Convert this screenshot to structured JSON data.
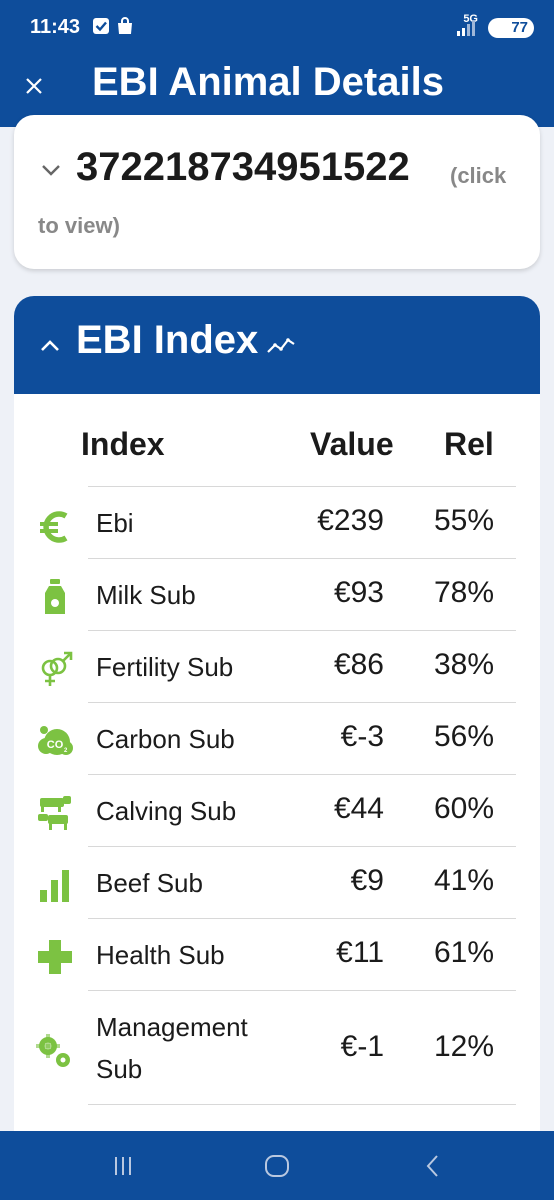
{
  "status_bar": {
    "time": "11:43",
    "network": "5G",
    "battery": "77"
  },
  "app_bar": {
    "title": "EBI Animal Details",
    "close_icon": "close-icon"
  },
  "animal": {
    "id": "372218734951522",
    "hint_part1": "(click",
    "hint_part2": "to view)"
  },
  "ebi": {
    "title": "EBI Index",
    "columns": {
      "index": "Index",
      "value": "Value",
      "rel": "Rel"
    },
    "rows": [
      {
        "name": "Ebi",
        "value": "€239",
        "rel": "55%",
        "icon": "euro-icon"
      },
      {
        "name": "Milk Sub",
        "value": "€93",
        "rel": "78%",
        "icon": "milk-bottle-icon"
      },
      {
        "name": "Fertility Sub",
        "value": "€86",
        "rel": "38%",
        "icon": "gender-icon"
      },
      {
        "name": "Carbon Sub",
        "value": "€-3",
        "rel": "56%",
        "icon": "co2-cloud-icon"
      },
      {
        "name": "Calving Sub",
        "value": "€44",
        "rel": "60%",
        "icon": "cow-calf-icon"
      },
      {
        "name": "Beef Sub",
        "value": "€9",
        "rel": "41%",
        "icon": "bar-chart-icon"
      },
      {
        "name": "Health Sub",
        "value": "€11",
        "rel": "61%",
        "icon": "health-cross-icon"
      },
      {
        "name_line1": "Management",
        "name_line2": "Sub",
        "value": "€-1",
        "rel": "12%",
        "icon": "gears-icon"
      }
    ]
  },
  "colors": {
    "primary": "#0e4d9b",
    "icon_green": "#7cc242"
  }
}
